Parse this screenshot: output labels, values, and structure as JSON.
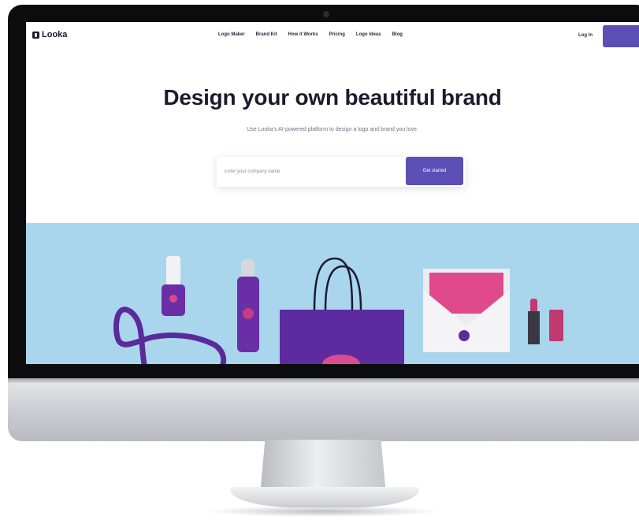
{
  "app": {
    "name": "Looka"
  },
  "nav": {
    "links": [
      "Logo Maker",
      "Brand Kit",
      "How it Works",
      "Pricing",
      "Logo Ideas",
      "Blog"
    ],
    "login": "Log In"
  },
  "hero": {
    "title": "Design your own beautiful brand",
    "subtitle": "Use Looka's AI-powered platform to design a logo and brand you love.",
    "input_placeholder": "Enter your company name",
    "cta_label": "Get started"
  },
  "banner": {
    "background": "#a9d6ec",
    "items": [
      "ribbon",
      "nail-polish",
      "spray-can",
      "shopping-bag",
      "envelope",
      "lipstick"
    ]
  },
  "colors": {
    "accent": "#5c4fb5",
    "product_purple": "#6a2fa6",
    "product_pink": "#e04a8b",
    "text_dark": "#1b1b2f"
  }
}
